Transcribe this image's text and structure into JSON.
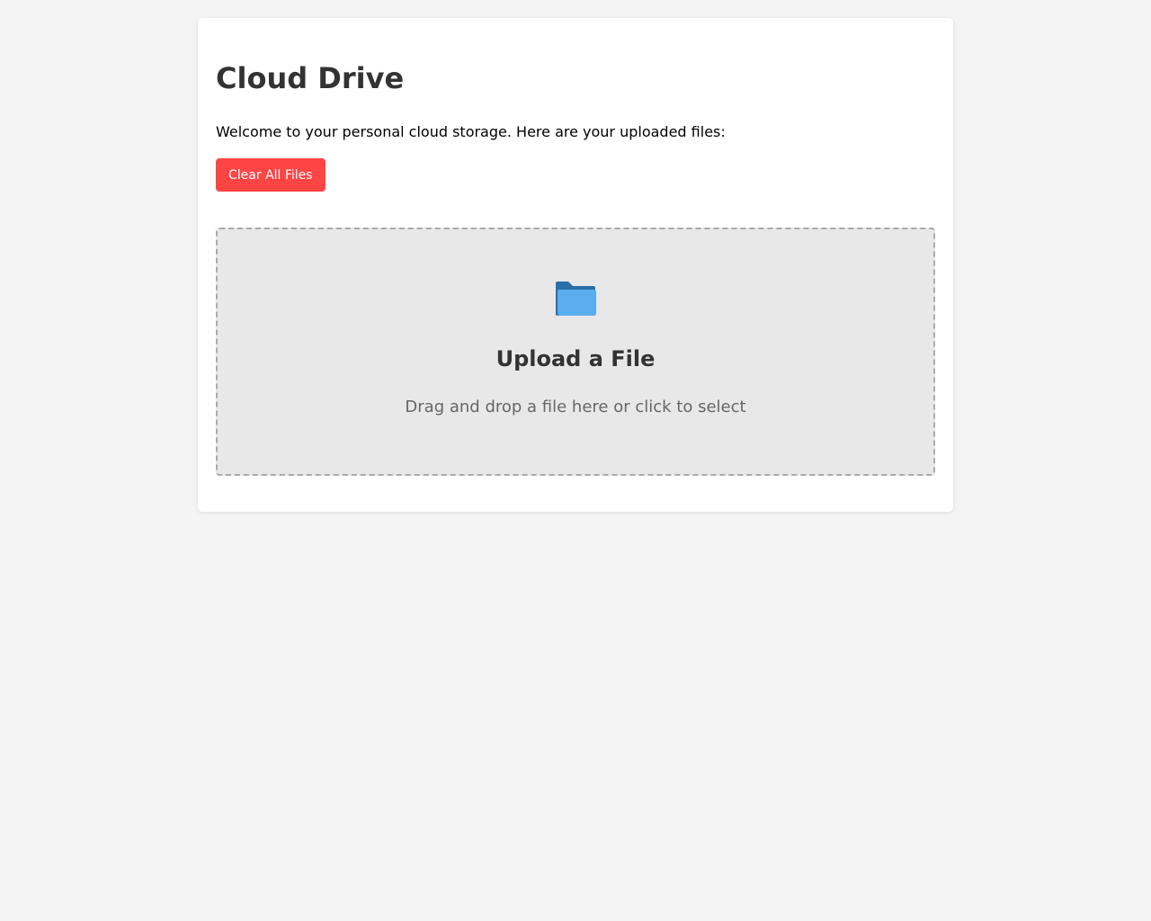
{
  "page": {
    "title": "Cloud Drive",
    "welcome_text": "Welcome to your personal cloud storage. Here are your uploaded files:"
  },
  "actions": {
    "clear_label": "Clear All Files"
  },
  "upload": {
    "icon": "folder-icon",
    "title": "Upload a File",
    "hint": "Drag and drop a file here or click to select"
  },
  "colors": {
    "background": "#f4f4f4",
    "card": "#ffffff",
    "danger": "#ff4444",
    "folder_dark": "#2a6fa8",
    "folder_light": "#5aaeee",
    "dropzone": "#e8e8e8"
  }
}
